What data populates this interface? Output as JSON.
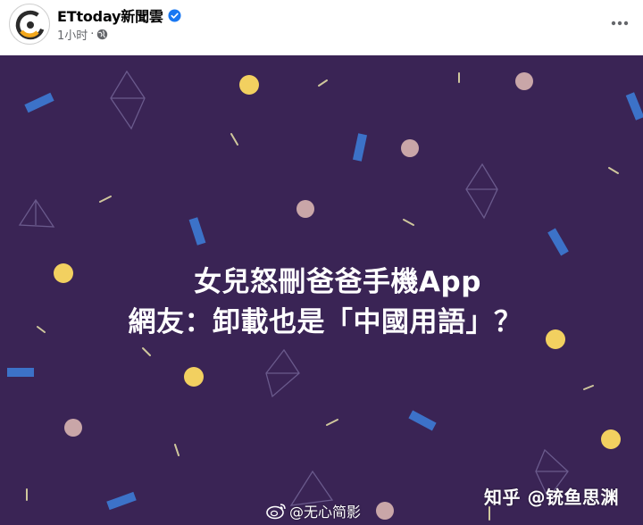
{
  "post": {
    "page_name": "ETtoday新聞雲",
    "time": "1小时",
    "separator": "·",
    "icons": {
      "avatar": "ettoday-logo",
      "verified": "verified-badge-icon",
      "audience": "globe-icon",
      "more": "more-horizontal-icon"
    }
  },
  "image": {
    "headline_line1": "女兒怒刪爸爸手機App",
    "headline_line2": "網友：卸載也是「中國用語」？",
    "colors": {
      "background": "#3a2455",
      "headline": "#ffffff",
      "dot_gold": "#f2d060",
      "dot_rose": "#c9a6a8",
      "bar_blue": "#3c72c8"
    }
  },
  "watermarks": {
    "weibo": "@无心简影",
    "zhihu": "知乎 @铳鱼思渊"
  },
  "colors": {
    "verified_blue": "#1877f2",
    "meta_gray": "#65676b",
    "name_black": "#050505"
  }
}
